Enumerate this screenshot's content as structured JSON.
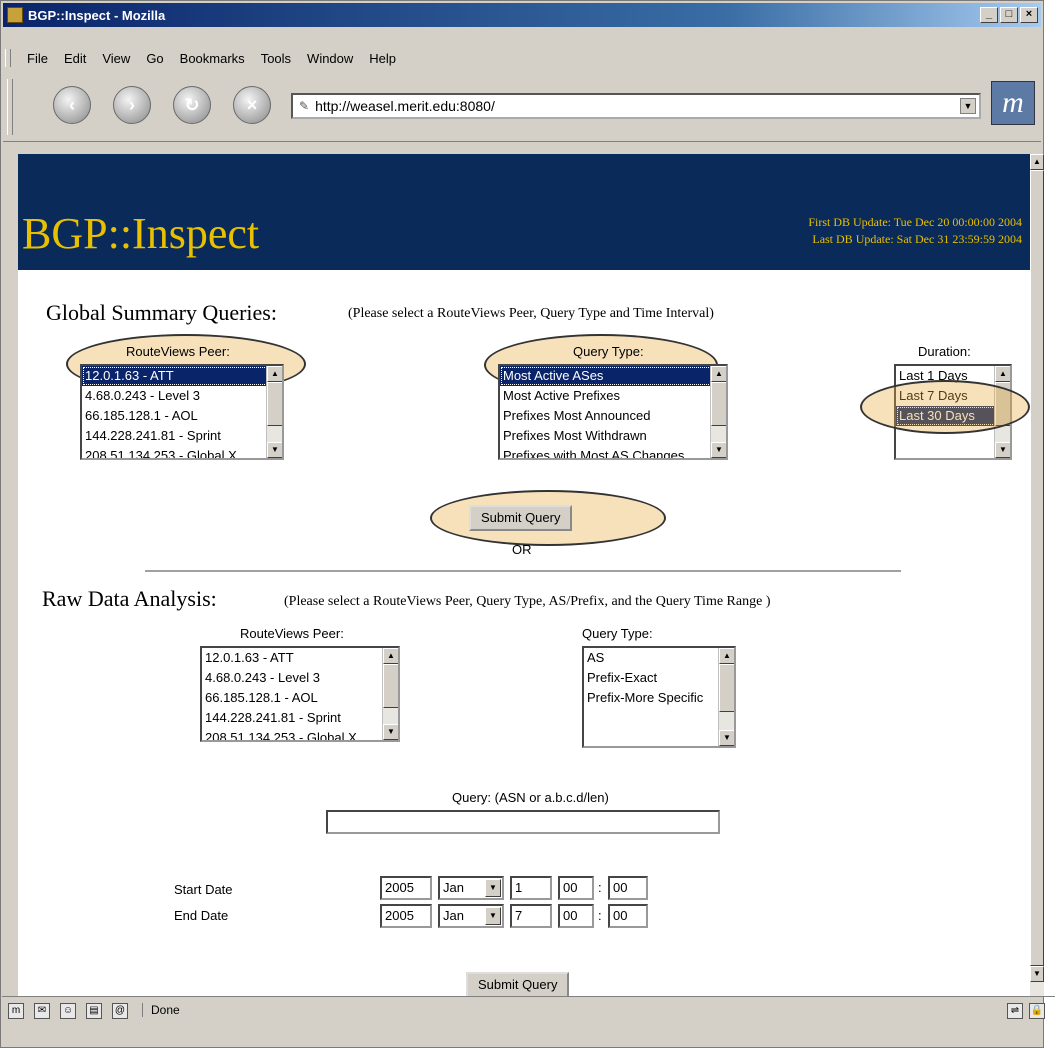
{
  "window": {
    "title": "BGP::Inspect - Mozilla",
    "controls": [
      "_",
      "□",
      "×"
    ]
  },
  "menu": [
    "File",
    "Edit",
    "View",
    "Go",
    "Bookmarks",
    "Tools",
    "Window",
    "Help"
  ],
  "nav": {
    "back": "‹",
    "forward": "›",
    "reload": "↻",
    "stop": "×",
    "url": "http://weasel.merit.edu:8080/",
    "url_icon": "✎",
    "logo": "m"
  },
  "banner": {
    "title": "BGP::Inspect",
    "first_update": "First DB Update: Tue Dec 20 00:00:00 2004",
    "last_update": "Last DB Update: Sat Dec 31 23:59:59 2004"
  },
  "global": {
    "title": "Global Summary Queries:",
    "note": "(Please select a RouteViews Peer, Query Type and Time Interval)",
    "peer_label": "RouteViews Peer:",
    "peers": [
      "12.0.1.63 - ATT",
      "4.68.0.243 - Level 3",
      "66.185.128.1 - AOL",
      "144.228.241.81 - Sprint",
      "208.51.134.253 - Global X"
    ],
    "query_type_label": "Query Type:",
    "query_types": [
      "Most Active ASes",
      "Most Active Prefixes",
      "Prefixes Most Announced",
      "Prefixes Most Withdrawn",
      "Prefixes with Most AS Changes"
    ],
    "duration_label": "Duration:",
    "durations": [
      "Last 1 Days",
      "Last 7 Days",
      "Last 30 Days"
    ],
    "submit": "Submit Query",
    "or": "OR"
  },
  "raw": {
    "title": "Raw Data Analysis:",
    "note": "(Please select a RouteViews Peer, Query Type, AS/Prefix, and the Query Time Range )",
    "peer_label": "RouteViews Peer:",
    "peers": [
      "12.0.1.63 - ATT",
      "4.68.0.243 - Level 3",
      "66.185.128.1 - AOL",
      "144.228.241.81 - Sprint",
      "208.51.134.253 - Global X"
    ],
    "query_type_label": "Query Type:",
    "query_types": [
      "AS",
      "Prefix-Exact",
      "Prefix-More Specific"
    ],
    "query_label": "Query: (ASN or a.b.c.d/len)",
    "query_value": "",
    "start_label": "Start Date",
    "end_label": "End Date",
    "start": {
      "year": "2005",
      "month": "Jan",
      "day": "1",
      "hour": "00",
      "minute": "00"
    },
    "end": {
      "year": "2005",
      "month": "Jan",
      "day": "7",
      "hour": "00",
      "minute": "00"
    },
    "colon": ":",
    "submit": "Submit Query"
  },
  "status": {
    "text": "Done"
  }
}
